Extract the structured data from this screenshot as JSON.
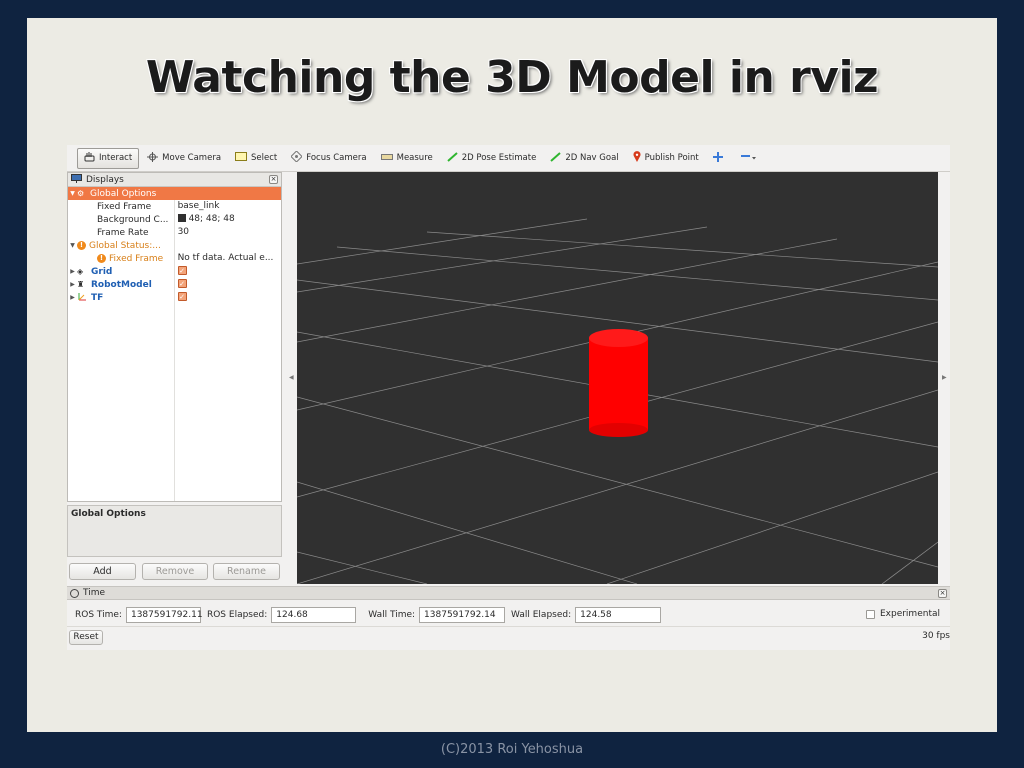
{
  "slide": {
    "title": "Watching the 3D Model in rviz",
    "footer": "(C)2013 Roi Yehoshua"
  },
  "toolbar": {
    "items": [
      {
        "label": "Interact",
        "icon": "hand-icon",
        "active": true
      },
      {
        "label": "Move Camera",
        "icon": "move-camera-icon"
      },
      {
        "label": "Select",
        "icon": "select-icon"
      },
      {
        "label": "Focus Camera",
        "icon": "focus-camera-icon"
      },
      {
        "label": "Measure",
        "icon": "ruler-icon"
      },
      {
        "label": "2D Pose Estimate",
        "icon": "green-arrow-icon"
      },
      {
        "label": "2D Nav Goal",
        "icon": "green-arrow-icon"
      },
      {
        "label": "Publish Point",
        "icon": "map-pin-icon"
      }
    ]
  },
  "displays": {
    "title": "Displays",
    "rows": [
      {
        "name": "Global Options",
        "value": ""
      },
      {
        "name": "Fixed Frame",
        "value": "base_link"
      },
      {
        "name": "Background C...",
        "value": "48; 48; 48"
      },
      {
        "name": "Frame Rate",
        "value": "30"
      },
      {
        "name": "Global Status:...",
        "value": ""
      },
      {
        "name": "Fixed Frame",
        "value": "No tf data.  Actual e..."
      },
      {
        "name": "Grid",
        "value": ""
      },
      {
        "name": "RobotModel",
        "value": ""
      },
      {
        "name": "TF",
        "value": ""
      }
    ]
  },
  "properties": {
    "title": "Global Options"
  },
  "buttons": {
    "add": "Add",
    "remove": "Remove",
    "rename": "Rename"
  },
  "time": {
    "title": "Time",
    "ros_time_label": "ROS Time:",
    "ros_time": "1387591792.11",
    "ros_elapsed_label": "ROS Elapsed:",
    "ros_elapsed": "124.68",
    "wall_time_label": "Wall Time:",
    "wall_time": "1387591792.14",
    "wall_elapsed_label": "Wall Elapsed:",
    "wall_elapsed": "124.58",
    "experimental_label": "Experimental",
    "reset_label": "Reset",
    "fps": "30 fps"
  },
  "colors": {
    "background": "#303030",
    "grid": "#a0a0a0",
    "cylinder": "#ff0000",
    "selection": "#f07845"
  }
}
